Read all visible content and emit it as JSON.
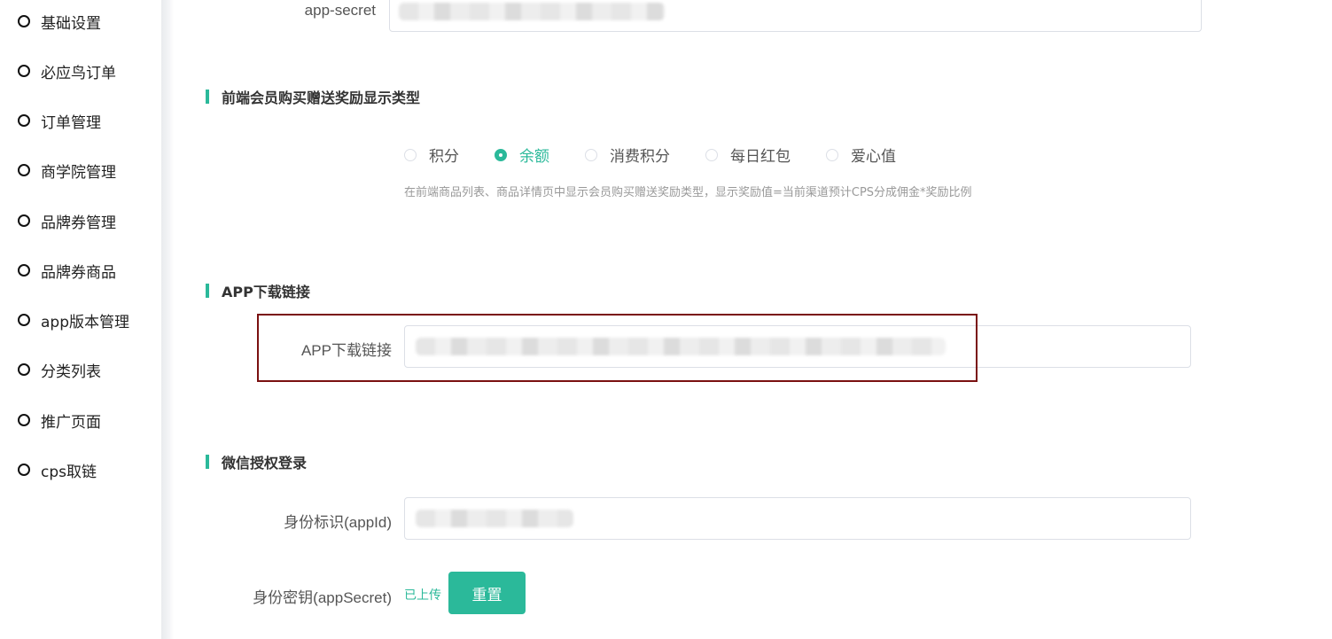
{
  "sidebar": {
    "items": [
      {
        "label": "基础设置"
      },
      {
        "label": "必应鸟订单"
      },
      {
        "label": "订单管理"
      },
      {
        "label": "商学院管理"
      },
      {
        "label": "品牌券管理"
      },
      {
        "label": "品牌券商品"
      },
      {
        "label": "app版本管理"
      },
      {
        "label": "分类列表"
      },
      {
        "label": "推广页面"
      },
      {
        "label": "cps取链"
      }
    ]
  },
  "form": {
    "app_secret": {
      "label": "app-secret"
    },
    "reward_section": {
      "title": "前端会员购买赠送奖励显示类型",
      "options": [
        {
          "label": "积分",
          "checked": false
        },
        {
          "label": "余额",
          "checked": true
        },
        {
          "label": "消费积分",
          "checked": false
        },
        {
          "label": "每日红包",
          "checked": false
        },
        {
          "label": "爱心值",
          "checked": false
        }
      ],
      "hint": "在前端商品列表、商品详情页中显示会员购买赠送奖励类型，显示奖励值=当前渠道预计CPS分成佣金*奖励比例"
    },
    "app_download": {
      "title": "APP下载链接",
      "label": "APP下载链接"
    },
    "wechat": {
      "title": "微信授权登录",
      "appid_label": "身份标识(appId)",
      "secret_label": "身份密钥(appSecret)",
      "uploaded_text": "已上传",
      "reset_label": "重置"
    }
  },
  "colors": {
    "accent": "#2bb99a",
    "highlight": "#7a1010"
  }
}
